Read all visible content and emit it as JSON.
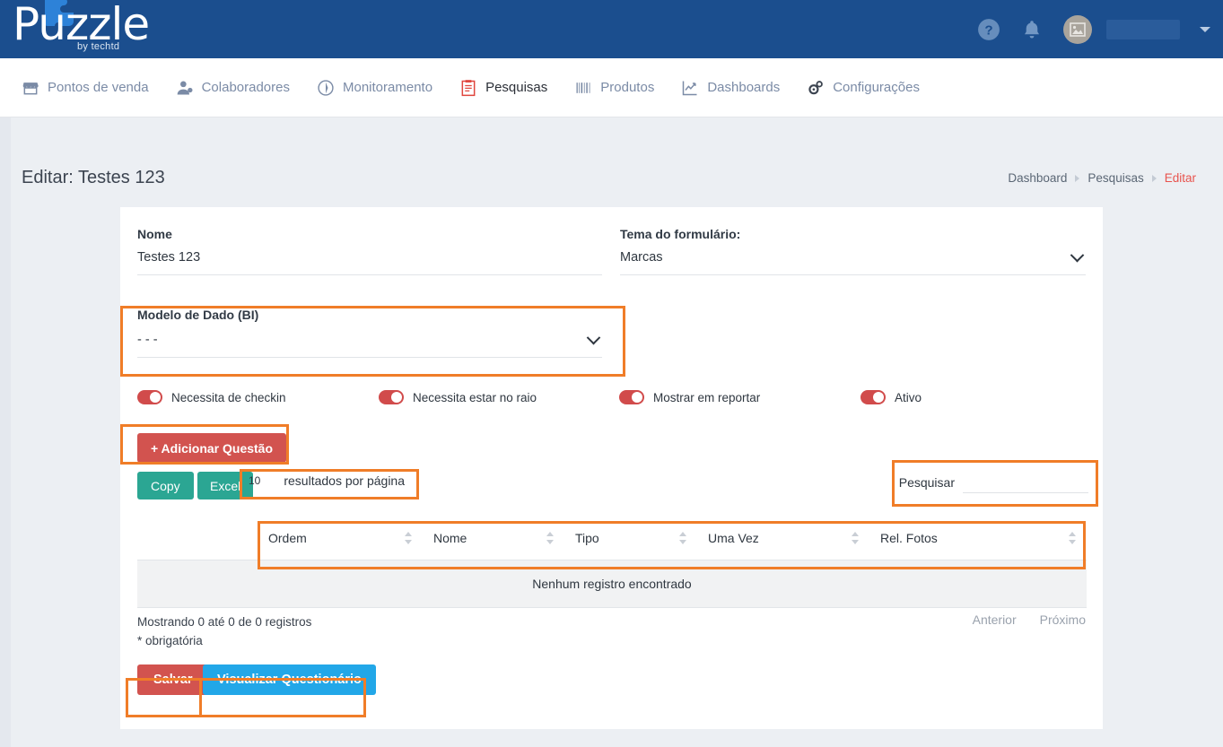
{
  "brand": {
    "name": "Puzzle",
    "tagline": "by techtd",
    "header_bg": "#1b4e8e",
    "accent_red": "#e8544e",
    "accent_orange": "#f07d28",
    "accent_teal": "#2ba693",
    "accent_blue": "#22a7e8"
  },
  "topbar": {
    "help_icon": "help-circle-icon",
    "bell_icon": "bell-icon",
    "avatar_icon": "image-placeholder-icon",
    "user_name": "",
    "caret_icon": "chevron-down-icon"
  },
  "nav": {
    "items": [
      {
        "label": "Pontos de venda",
        "icon": "store-icon",
        "active": false
      },
      {
        "label": "Colaboradores",
        "icon": "user-icon",
        "active": false
      },
      {
        "label": "Monitoramento",
        "icon": "compass-icon",
        "active": false
      },
      {
        "label": "Pesquisas",
        "icon": "clipboard-icon",
        "active": true
      },
      {
        "label": "Produtos",
        "icon": "barcode-icon",
        "active": false
      },
      {
        "label": "Dashboards",
        "icon": "chart-line-icon",
        "active": false
      },
      {
        "label": "Configurações",
        "icon": "gears-icon",
        "active": false
      }
    ]
  },
  "page": {
    "title": "Editar: Testes 123",
    "breadcrumb": [
      "Dashboard",
      "Pesquisas",
      "Editar"
    ]
  },
  "form": {
    "nome_label": "Nome",
    "nome_value": "Testes 123",
    "tema_label": "Tema do formulário:",
    "tema_value": "Marcas",
    "modelo_label": "Modelo de Dado (BI)",
    "modelo_value": "- - -",
    "toggles": [
      {
        "label": "Necessita de checkin",
        "on": true
      },
      {
        "label": "Necessita estar no raio",
        "on": true
      },
      {
        "label": "Mostrar em reportar",
        "on": true
      },
      {
        "label": "Ativo",
        "on": true
      }
    ]
  },
  "toolbar": {
    "add_question_label": "+ Adicionar Questão",
    "copy_label": "Copy",
    "excel_label": "Excel",
    "page_length_value": "10",
    "page_length_suffix": "resultados por página",
    "search_label": "Pesquisar",
    "search_value": "",
    "search_placeholder": ""
  },
  "table": {
    "columns": [
      "",
      "Ordem",
      "Nome",
      "Tipo",
      "Uma Vez",
      "Rel. Fotos"
    ],
    "rows": [],
    "empty_message": "Nenhum registro encontrado",
    "info": "Mostrando 0 até 0 de 0 registros",
    "required_note": "* obrigatória",
    "pagination": {
      "previous": "Anterior",
      "next": "Próximo"
    }
  },
  "actions": {
    "save_label": "Salvar",
    "preview_label": "Visualizar Questionário"
  }
}
